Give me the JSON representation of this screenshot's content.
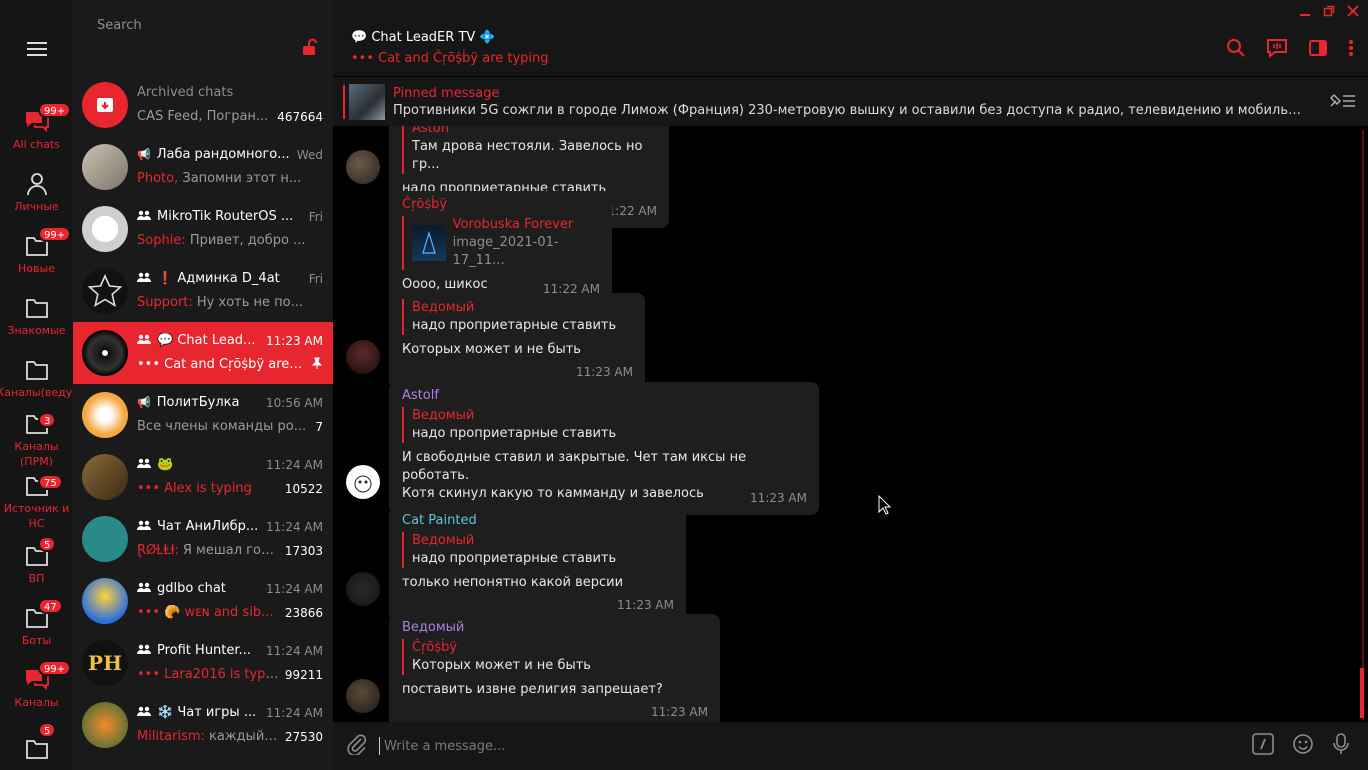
{
  "window": {
    "minimize": "—",
    "restore": "❐",
    "close": "✕"
  },
  "folders": [
    {
      "label": "All chats",
      "badge": "99+",
      "icon": "chat-bubbles-icon",
      "active": true
    },
    {
      "label": "Личные",
      "badge": "",
      "icon": "person-icon"
    },
    {
      "label": "Новые",
      "badge": "99+",
      "icon": "folder-icon"
    },
    {
      "label": "Знакомые",
      "badge": "",
      "icon": "folder-icon"
    },
    {
      "label": "Каналы(веду)",
      "badge": "",
      "icon": "folder-icon"
    },
    {
      "label": "Каналы (ПРМ)",
      "badge": "3",
      "icon": "folder-icon"
    },
    {
      "label": "Источник и НС",
      "badge": "75",
      "icon": "folder-icon"
    },
    {
      "label": "ВП",
      "badge": "5",
      "icon": "folder-icon"
    },
    {
      "label": "Боты",
      "badge": "47",
      "icon": "folder-icon"
    },
    {
      "label": "Каналы",
      "badge": "99+",
      "icon": "chat-bubbles-icon"
    },
    {
      "label": "",
      "badge": "5",
      "icon": "folder-icon"
    }
  ],
  "search": {
    "placeholder": "Search"
  },
  "chats": [
    {
      "name": "Archived chats",
      "time": "",
      "from": "",
      "msg": "CAS Feed, Погран...",
      "count": "467664",
      "type": "archive"
    },
    {
      "name": "Лаба рандомного...",
      "time": "Wed",
      "from": "Photo, ",
      "msg": "Запомни этот н...",
      "count": "",
      "type": "channel"
    },
    {
      "name": "MikroTik RouterOS ...",
      "time": "Fri",
      "from": "Sophie: ",
      "msg": "Привет, добро ...",
      "count": "",
      "type": "group"
    },
    {
      "name": "❗ Админка D_4at",
      "time": "Fri",
      "from": "Support: ",
      "msg": "Ну хоть не по...",
      "count": "",
      "type": "group"
    },
    {
      "name": "💬 Chat Lead...",
      "time": "11:23 AM",
      "from": "••• ",
      "msg": "Cat and Ĉŗōṩḃÿ are t...",
      "count": "",
      "type": "group",
      "active": true
    },
    {
      "name": "ПолитБулка",
      "time": "10:56 AM",
      "from": "",
      "msg": "Все члены команды ро...",
      "count": "7",
      "type": "channel"
    },
    {
      "name": "🐸",
      "time": "11:24 AM",
      "from": "••• Alex is typing",
      "msg": "",
      "count": "10522",
      "type": "group"
    },
    {
      "name": "Чат АниЛибр...",
      "time": "11:24 AM",
      "from": "ⱤǾⱢⱠⱡ: ",
      "msg": "Я мешал гор...",
      "count": "17303",
      "type": "group"
    },
    {
      "name": "gdlbo chat",
      "time": "11:24 AM",
      "from": "••• 🥐 wᴇɴ and sib...",
      "msg": "",
      "count": "23866",
      "type": "group"
    },
    {
      "name": "Profit Hunter...",
      "time": "11:24 AM",
      "from": "••• Lara2016 is typing",
      "msg": "",
      "count": "99211",
      "type": "group"
    },
    {
      "name": "❄️ Чат игры ...",
      "time": "11:24 AM",
      "from": "Militarism: ",
      "msg": "каждый ...",
      "count": "27530",
      "type": "group"
    }
  ],
  "header": {
    "title": "💬 Chat LeadER TV 💠",
    "subtitle": "••• Cat and Ĉŗōṩḃÿ are typing"
  },
  "pinned": {
    "title": "Pinned message",
    "text": "Противники 5G сожгли в городе Лимож (Франция) 230-метровую вышку и оставили без доступа к радио, телевидению и мобильной связи 1,..."
  },
  "messages": [
    {
      "author": "",
      "reply_name": "Aston",
      "reply_text": "Там дрова нестояли. Завелось но гр...",
      "text": "надо проприетарные ставить",
      "time": "11:22 AM",
      "author_color": "#e8262f"
    },
    {
      "author": "Ĉŗōṩḃÿ",
      "reply_name": "Vorobuska     Forever",
      "reply_text": "image_2021-01-17_11...",
      "text": "Оооо, шикос",
      "time": "11:22 AM",
      "author_color": "#e8262f"
    },
    {
      "author": "",
      "reply_name": "Ведомый",
      "reply_text": "надо проприетарные ставить",
      "text": "Которых может и не быть",
      "time": "11:23 AM",
      "author_color": "#e8262f"
    },
    {
      "author": "Astolf",
      "reply_name": "Ведомый",
      "reply_text": "надо проприетарные ставить",
      "text": "И свободные ставил и закрытые. Чет там иксы не роботать.",
      "text2": "Котя скинул какую то  камманду и завелось",
      "time": "11:23 AM",
      "author_color": "#b07fe0"
    },
    {
      "author": "Cat Painted",
      "reply_name": "Ведомый",
      "reply_text": "надо проприетарные ставить",
      "text": "только непонятно какой версии",
      "time": "11:23 AM",
      "author_color": "#5ec6d8"
    },
    {
      "author": "Ведомый",
      "reply_name": "Ĉŗōṩḃÿ",
      "reply_text": "Которых может и не быть",
      "text": "поставить извне религия запрещает?",
      "time": "11:23 AM",
      "author_color": "#b07fe0"
    }
  ],
  "composer": {
    "placeholder": "Write a message..."
  },
  "colors": {
    "accent": "#e8262f",
    "bg": "#000000",
    "panel": "#1a1a1a"
  }
}
